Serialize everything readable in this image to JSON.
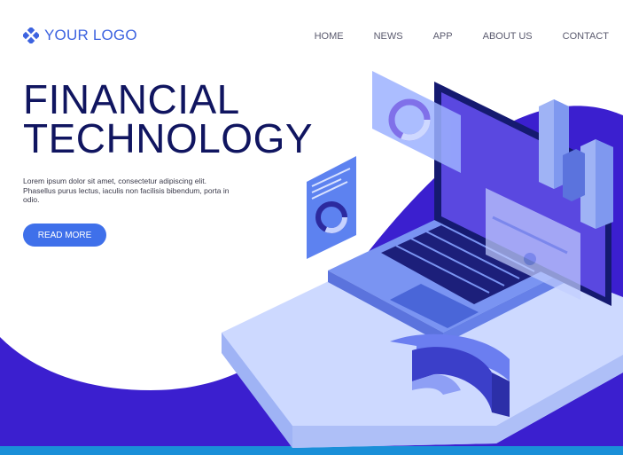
{
  "brand": {
    "logo_text": "YOUR LOGO",
    "icon": "diamond-cluster-icon",
    "accent": "#3d63e0"
  },
  "nav": {
    "items": [
      "HOME",
      "NEWS",
      "APP",
      "ABOUT US",
      "CONTACT"
    ]
  },
  "hero": {
    "title_line1": "FINANCIAL",
    "title_line2": "TECHNOLOGY",
    "description": "Lorem ipsum dolor sit amet, consectetur adipiscing elit. Phasellus purus lectus, iaculis non facilisis bibendum, porta in odio.",
    "cta_label": "READ MORE"
  },
  "colors": {
    "title": "#101560",
    "cta": "#3f70ea",
    "wave": "#3b1fcf",
    "bottom_bar": "#1a8fd8"
  },
  "illustration": {
    "subject": "isometric laptop with floating charts"
  }
}
